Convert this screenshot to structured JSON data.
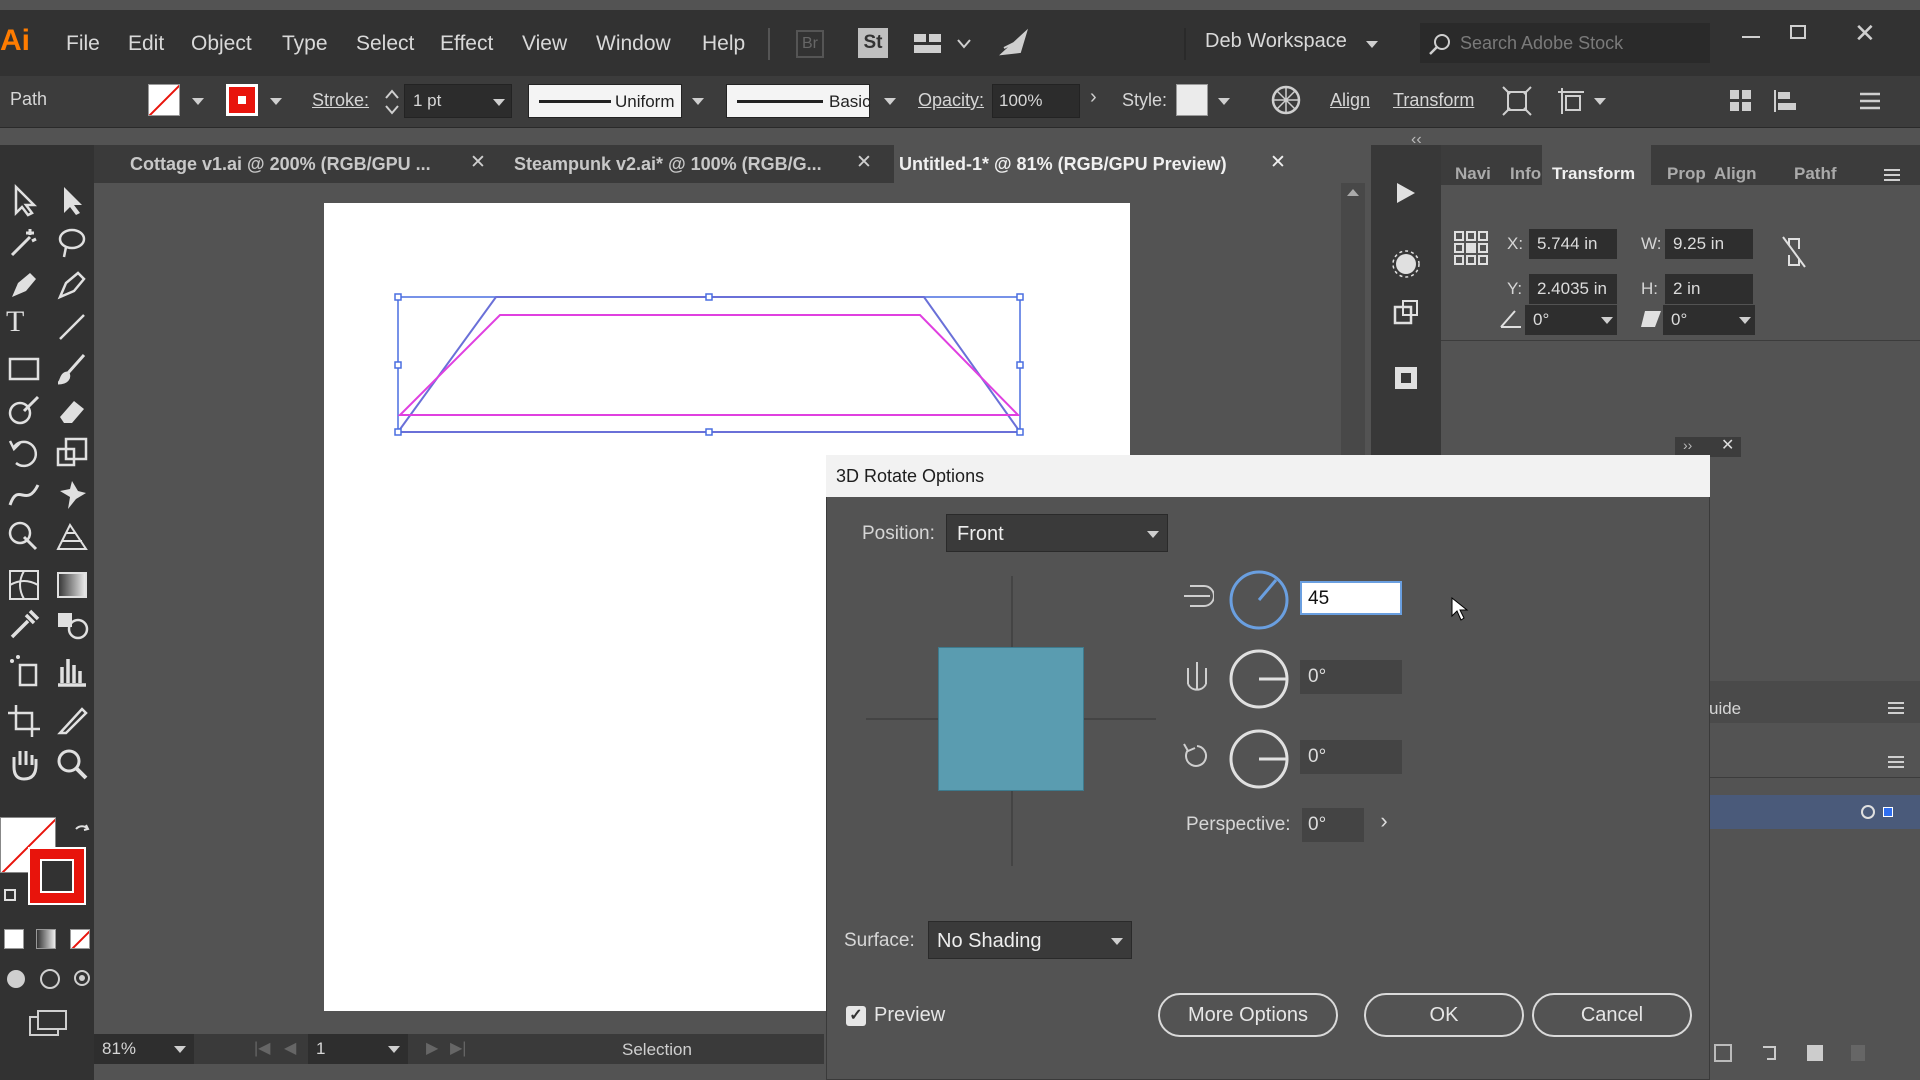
{
  "app": {
    "logo": "Ai",
    "accent": "#ff7c00"
  },
  "menu": {
    "items": [
      "File",
      "Edit",
      "Object",
      "Type",
      "Select",
      "Effect",
      "View",
      "Window",
      "Help"
    ],
    "br": "Br",
    "st": "St",
    "workspace": "Deb Workspace",
    "search_placeholder": "Search Adobe Stock"
  },
  "control": {
    "selection_type": "Path",
    "stroke_label": "Stroke:",
    "stroke_weight": "1 pt",
    "profile": "Uniform",
    "brush": "Basic",
    "opacity_label": "Opacity:",
    "opacity": "100%",
    "style_label": "Style:",
    "align": "Align",
    "transform": "Transform"
  },
  "tabs": [
    {
      "label": "Cottage v1.ai @ 200% (RGB/GPU ...",
      "active": false
    },
    {
      "label": "Steampunk v2.ai* @ 100% (RGB/G...",
      "active": false
    },
    {
      "label": "Untitled-1* @ 81% (RGB/GPU Preview)",
      "active": true
    }
  ],
  "panel": {
    "tabs": [
      "Navi",
      "Info",
      "Transform",
      "Prop",
      "Align",
      "Pathf"
    ],
    "active_tab": "Transform",
    "x_label": "X:",
    "x": "5.744 in",
    "y_label": "Y:",
    "y": "2.4035 in",
    "w_label": "W:",
    "w": "9.25 in",
    "h_label": "H:",
    "h": "2 in",
    "angle": "0°",
    "shear": "0°",
    "lower_label": "uide"
  },
  "dialog": {
    "title": "3D Rotate Options",
    "position_label": "Position:",
    "position": "Front",
    "x_rotation": "45",
    "y_rotation": "0°",
    "z_rotation": "0°",
    "perspective_label": "Perspective:",
    "perspective": "0°",
    "surface_label": "Surface:",
    "surface": "No Shading",
    "preview_label": "Preview",
    "preview_checked": true,
    "more_options": "More Options",
    "ok": "OK",
    "cancel": "Cancel",
    "cube_color": "#5a9cb0"
  },
  "status": {
    "zoom": "81%",
    "artboard": "1",
    "tool": "Selection"
  },
  "colors": {
    "selection_blue": "#4a6ee0",
    "path_magenta": "#e040e0",
    "stroke_red": "#e8140c"
  }
}
